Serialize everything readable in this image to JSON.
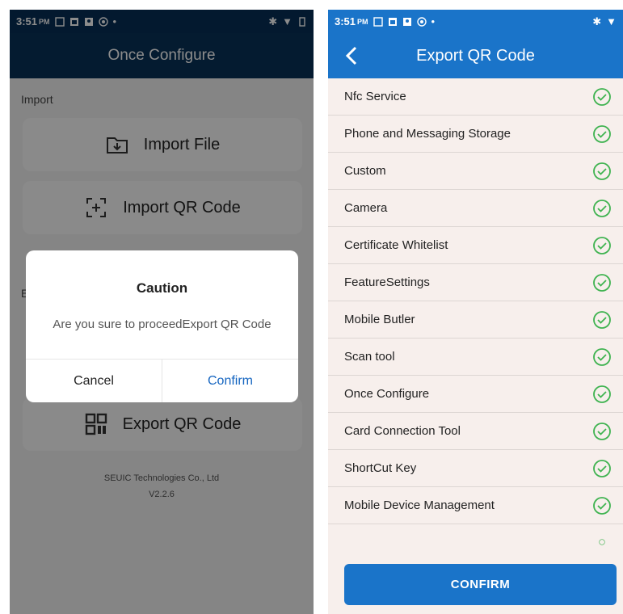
{
  "colors": {
    "left_header": "#083258",
    "right_header": "#1a74c9",
    "check": "#3fb350",
    "confirm_link": "#1565c0"
  },
  "left": {
    "status": {
      "time": "3:51",
      "ampm": "PM"
    },
    "title": "Once Configure",
    "import_label": "Import",
    "import_file": "Import File",
    "import_qr": "Import QR Code",
    "export_label_partial": "E",
    "export_qr": "Export QR Code",
    "company": "SEUIC Technologies Co., Ltd",
    "version": "V2.2.6",
    "dialog": {
      "title": "Caution",
      "message": "Are you sure to proceedExport QR Code",
      "cancel": "Cancel",
      "confirm": "Confirm"
    }
  },
  "right": {
    "status": {
      "time": "3:51",
      "ampm": "PM"
    },
    "title": "Export QR Code",
    "items": [
      {
        "label": "Nfc Service",
        "checked": true
      },
      {
        "label": "Phone and Messaging Storage",
        "checked": true
      },
      {
        "label": "Custom",
        "checked": true
      },
      {
        "label": "Camera",
        "checked": true
      },
      {
        "label": "Certificate Whitelist",
        "checked": true
      },
      {
        "label": "FeatureSettings",
        "checked": true
      },
      {
        "label": "Mobile Butler",
        "checked": true
      },
      {
        "label": "Scan tool",
        "checked": true
      },
      {
        "label": "Once Configure",
        "checked": true
      },
      {
        "label": "Card Connection Tool",
        "checked": true
      },
      {
        "label": "ShortCut Key",
        "checked": true
      },
      {
        "label": "Mobile Device Management",
        "checked": true
      }
    ],
    "confirm_button": "CONFIRM"
  }
}
